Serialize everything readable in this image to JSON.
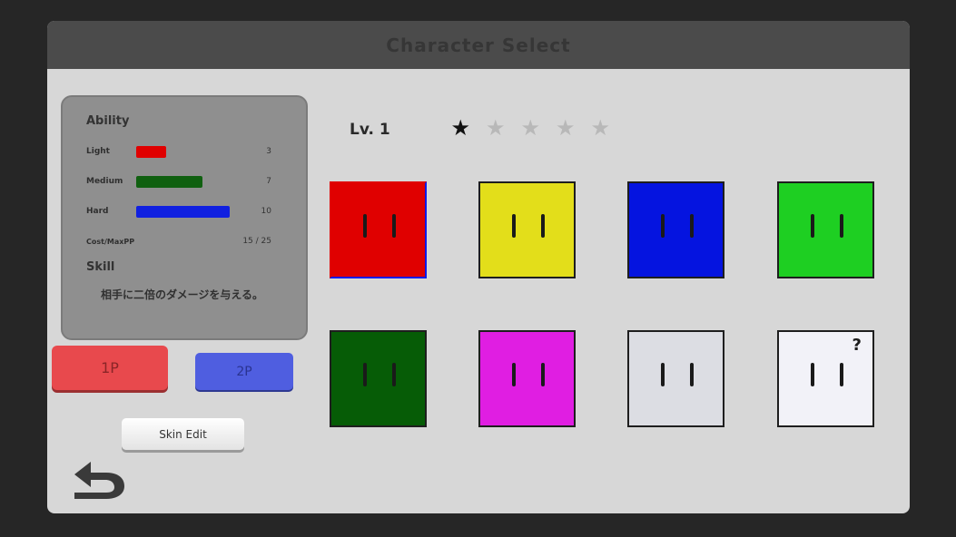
{
  "header": {
    "title": "Character Select"
  },
  "ability": {
    "title": "Ability",
    "stats": [
      {
        "label": "Light",
        "value": "3",
        "color": "#e00000"
      },
      {
        "label": "Medium",
        "value": "7",
        "color": "#106010"
      },
      {
        "label": "Hard",
        "value": "10",
        "color": "#1020e0"
      }
    ],
    "cost_label": "Cost/MaxPP",
    "cost_value": "15 / 25",
    "skill_title": "Skill",
    "skill_text": "相手に二倍のダメージを与える。"
  },
  "buttons": {
    "p1_label": "1P",
    "p2_label": "2P",
    "skin_edit_label": "Skin Edit"
  },
  "level": {
    "label": "Lv. 1",
    "stars_filled": 1,
    "stars_total": 5
  },
  "characters": [
    {
      "name": "red",
      "color": "#e00000",
      "selected": true
    },
    {
      "name": "yellow",
      "color": "#e3de1a"
    },
    {
      "name": "blue",
      "color": "#0514e0"
    },
    {
      "name": "green",
      "color": "#1ecf22"
    },
    {
      "name": "dark-green",
      "color": "#065c06"
    },
    {
      "name": "magenta",
      "color": "#e01ee2"
    },
    {
      "name": "light-gray",
      "color": "#dcdde3"
    },
    {
      "name": "white-random",
      "color": "#f2f2f8",
      "mark": "?"
    }
  ],
  "icons": {
    "back": "back-arrow-icon",
    "star": "star-icon"
  }
}
